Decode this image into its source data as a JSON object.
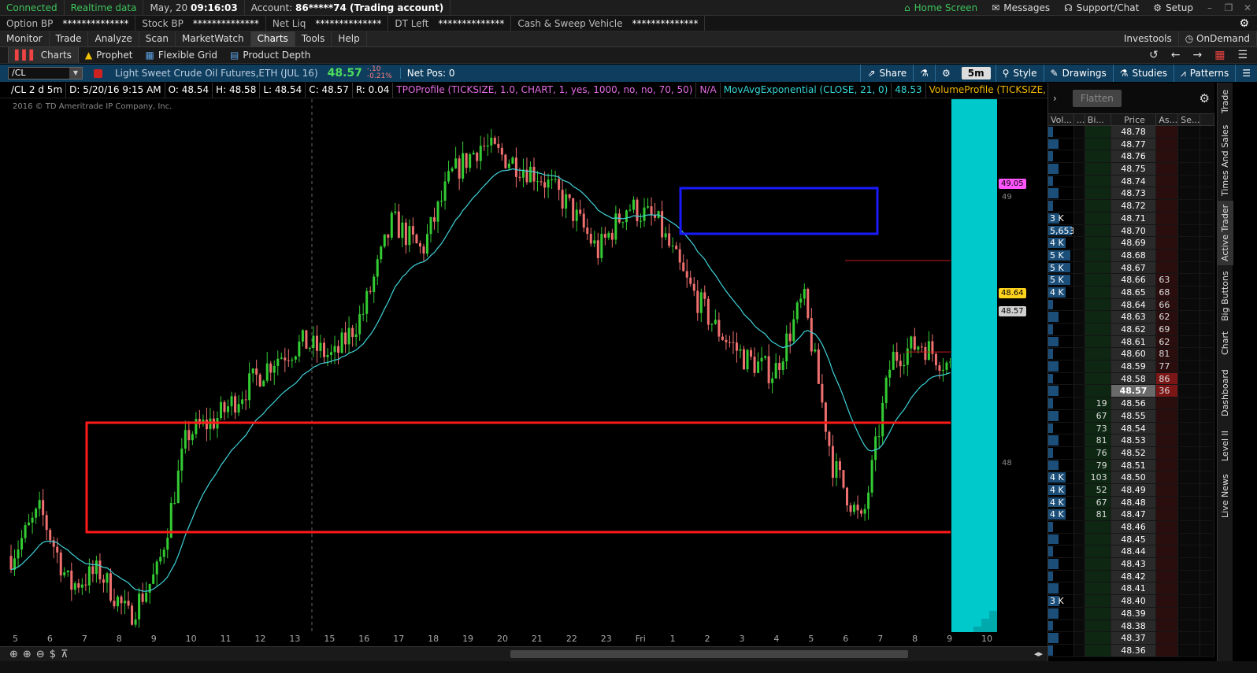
{
  "status": {
    "connected": "Connected",
    "realtime": "Realtime data",
    "date": "May, 20",
    "time": "09:16:03",
    "account_label": "Account:",
    "account_value": "86*****74 (Trading account)",
    "home": "Home Screen",
    "messages": "Messages",
    "support": "Support/Chat",
    "setup": "Setup"
  },
  "account_bar": [
    {
      "label": "Option BP",
      "value": "**************"
    },
    {
      "label": "Stock BP",
      "value": "**************"
    },
    {
      "label": "Net Liq",
      "value": "**************"
    },
    {
      "label": "DT Left",
      "value": "**************"
    },
    {
      "label": "Cash & Sweep Vehicle",
      "value": "**************"
    }
  ],
  "main_tabs": [
    "Monitor",
    "Trade",
    "Analyze",
    "Scan",
    "MarketWatch",
    "Charts",
    "Tools",
    "Help"
  ],
  "main_tabs_right": [
    "Investools",
    "OnDemand"
  ],
  "sub_tabs": [
    "Charts",
    "Prophet",
    "Flexible Grid",
    "Product Depth"
  ],
  "chart_header": {
    "symbol": "/CL",
    "description": "Light Sweet Crude Oil Futures,ETH (JUL 16)",
    "last": "48.57",
    "change": "-.10",
    "change_pct": "-0.21%",
    "net_pos": "Net Pos: 0",
    "share": "Share",
    "aggregation": "5m",
    "style": "Style",
    "drawings": "Drawings",
    "studies": "Studies",
    "patterns": "Patterns"
  },
  "study_bar": {
    "symbol_period": "/CL 2 d 5m",
    "date": "D: 5/20/16 9:15 AM",
    "open": "O: 48.54",
    "high": "H: 48.58",
    "low": "L: 48.54",
    "close": "C: 48.57",
    "range": "R: 0.04",
    "tpo": "TPOProfile (TICKSIZE, 1.0, CHART, 1, yes, 1000, no, no, 70, 50)",
    "na": "N/A",
    "mov": "MovAvgExponential (CLOSE, 21, 0)",
    "mov_val": "48.53",
    "vol": "VolumeProfile (TICKSIZE, 1.0, CHART, 1, yes, 1000, no,..."
  },
  "copyright": "2016 © TD Ameritrade IP Company, Inc.",
  "price_axis": {
    "labels": [
      "49",
      "48"
    ],
    "tag_magenta": "49.05",
    "tag_yellow": "48.64",
    "tag_gray": "48.57"
  },
  "time_axis": [
    "5",
    "6",
    "7",
    "8",
    "9",
    "10",
    "11",
    "12",
    "13",
    "15",
    "16",
    "17",
    "18",
    "19",
    "20",
    "21",
    "22",
    "23",
    "Fri",
    "1",
    "2",
    "3",
    "4",
    "5",
    "6",
    "7",
    "8",
    "9",
    "10"
  ],
  "active_trader": {
    "flatten": "Flatten",
    "headers": [
      "Vol...",
      "...",
      "Bi...",
      "Price",
      "As...",
      "Se..."
    ],
    "rows": [
      {
        "vol": "",
        "bid": "",
        "price": "48.78",
        "ask": ""
      },
      {
        "vol": "",
        "bid": "",
        "price": "48.77",
        "ask": ""
      },
      {
        "vol": "",
        "bid": "",
        "price": "48.76",
        "ask": ""
      },
      {
        "vol": "",
        "bid": "",
        "price": "48.75",
        "ask": ""
      },
      {
        "vol": "",
        "bid": "",
        "price": "48.74",
        "ask": ""
      },
      {
        "vol": "",
        "bid": "",
        "price": "48.73",
        "ask": ""
      },
      {
        "vol": "",
        "bid": "",
        "price": "48.72",
        "ask": ""
      },
      {
        "vol": "3 K",
        "bid": "",
        "price": "48.71",
        "ask": ""
      },
      {
        "vol": "5,653",
        "bid": "",
        "price": "48.70",
        "ask": ""
      },
      {
        "vol": "4 K",
        "bid": "",
        "price": "48.69",
        "ask": ""
      },
      {
        "vol": "5 K",
        "bid": "",
        "price": "48.68",
        "ask": ""
      },
      {
        "vol": "5 K",
        "bid": "",
        "price": "48.67",
        "ask": ""
      },
      {
        "vol": "5 K",
        "bid": "",
        "price": "48.66",
        "ask": "63"
      },
      {
        "vol": "4 K",
        "bid": "",
        "price": "48.65",
        "ask": "68"
      },
      {
        "vol": "",
        "bid": "",
        "price": "48.64",
        "ask": "66"
      },
      {
        "vol": "",
        "bid": "",
        "price": "48.63",
        "ask": "62"
      },
      {
        "vol": "",
        "bid": "",
        "price": "48.62",
        "ask": "69"
      },
      {
        "vol": "",
        "bid": "",
        "price": "48.61",
        "ask": "62"
      },
      {
        "vol": "",
        "bid": "",
        "price": "48.60",
        "ask": "81"
      },
      {
        "vol": "",
        "bid": "",
        "price": "48.59",
        "ask": "77"
      },
      {
        "vol": "",
        "bid": "",
        "price": "48.58",
        "ask": "86"
      },
      {
        "vol": "",
        "bid": "",
        "price": "48.57",
        "ask": "36"
      },
      {
        "vol": "",
        "bid": "19",
        "price": "48.56",
        "ask": ""
      },
      {
        "vol": "",
        "bid": "67",
        "price": "48.55",
        "ask": ""
      },
      {
        "vol": "",
        "bid": "73",
        "price": "48.54",
        "ask": ""
      },
      {
        "vol": "",
        "bid": "81",
        "price": "48.53",
        "ask": ""
      },
      {
        "vol": "",
        "bid": "76",
        "price": "48.52",
        "ask": ""
      },
      {
        "vol": "",
        "bid": "79",
        "price": "48.51",
        "ask": ""
      },
      {
        "vol": "4 K",
        "bid": "103",
        "price": "48.50",
        "ask": ""
      },
      {
        "vol": "4 K",
        "bid": "52",
        "price": "48.49",
        "ask": ""
      },
      {
        "vol": "4 K",
        "bid": "67",
        "price": "48.48",
        "ask": ""
      },
      {
        "vol": "4 K",
        "bid": "81",
        "price": "48.47",
        "ask": ""
      },
      {
        "vol": "",
        "bid": "",
        "price": "48.46",
        "ask": ""
      },
      {
        "vol": "",
        "bid": "",
        "price": "48.45",
        "ask": ""
      },
      {
        "vol": "",
        "bid": "",
        "price": "48.44",
        "ask": ""
      },
      {
        "vol": "",
        "bid": "",
        "price": "48.43",
        "ask": ""
      },
      {
        "vol": "",
        "bid": "",
        "price": "48.42",
        "ask": ""
      },
      {
        "vol": "",
        "bid": "",
        "price": "48.41",
        "ask": ""
      },
      {
        "vol": "3 K",
        "bid": "",
        "price": "48.40",
        "ask": ""
      },
      {
        "vol": "",
        "bid": "",
        "price": "48.39",
        "ask": ""
      },
      {
        "vol": "",
        "bid": "",
        "price": "48.38",
        "ask": ""
      },
      {
        "vol": "",
        "bid": "",
        "price": "48.37",
        "ask": ""
      },
      {
        "vol": "",
        "bid": "",
        "price": "48.36",
        "ask": ""
      }
    ]
  },
  "right_tabs": [
    "Trade",
    "Times And Sales",
    "Active Trader",
    "Big Buttons",
    "Chart",
    "Dashboard",
    "Level II",
    "Live News"
  ],
  "colors": {
    "up_candle": "#33cc33",
    "down_candle": "#f07070",
    "ema": "#3fd3d8",
    "volume_profile": "#00c9cc",
    "annotation_red": "#ff1a1a",
    "annotation_blue": "#1a1aff"
  },
  "chart_data": {
    "type": "candlestick",
    "symbol": "/CL",
    "aggregation": "5m",
    "price_range": [
      47.7,
      49.45
    ],
    "ema_period": 21,
    "approx_close_path": [
      47.95,
      48.1,
      47.85,
      47.9,
      47.75,
      47.9,
      48.35,
      48.4,
      48.5,
      48.6,
      48.65,
      48.6,
      48.75,
      49.05,
      48.95,
      49.2,
      49.3,
      49.25,
      49.2,
      49.1,
      48.95,
      49.1,
      49.05,
      48.85,
      48.7,
      48.6,
      48.55,
      48.8,
      48.25,
      48.05,
      48.6,
      48.65,
      48.57
    ]
  }
}
